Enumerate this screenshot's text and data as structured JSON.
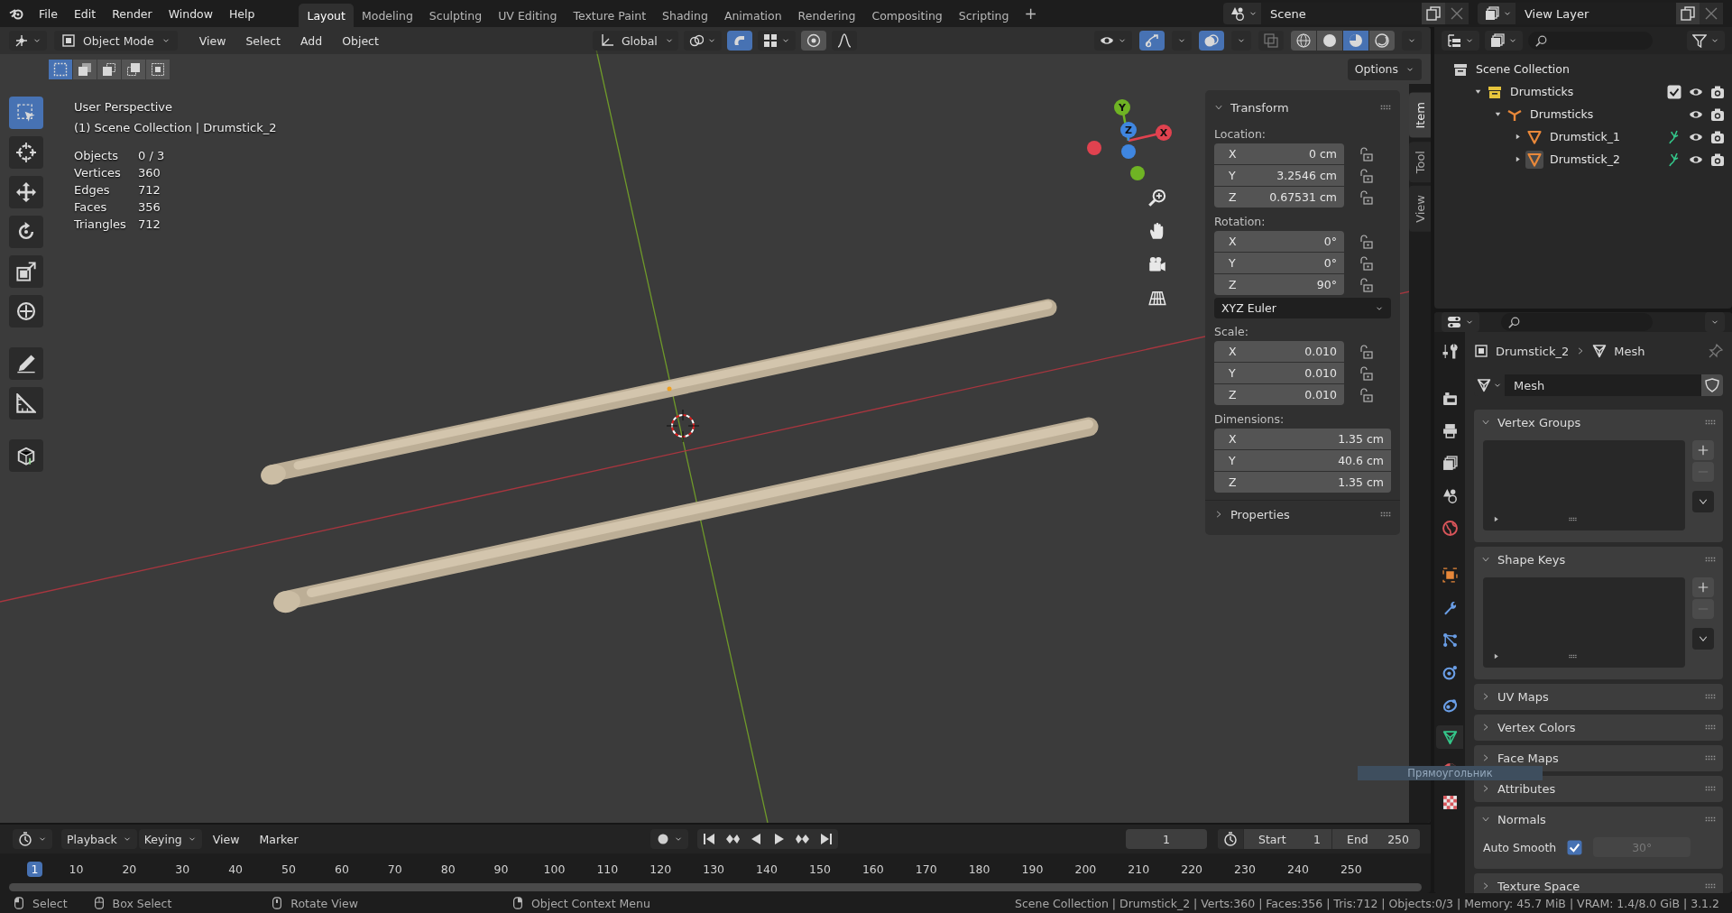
{
  "menu": [
    "File",
    "Edit",
    "Render",
    "Window",
    "Help"
  ],
  "workspaces": [
    {
      "label": "Layout",
      "selected": true
    },
    {
      "label": "Modeling",
      "selected": false
    },
    {
      "label": "Sculpting",
      "selected": false
    },
    {
      "label": "UV Editing",
      "selected": false
    },
    {
      "label": "Texture Paint",
      "selected": false
    },
    {
      "label": "Shading",
      "selected": false
    },
    {
      "label": "Animation",
      "selected": false
    },
    {
      "label": "Rendering",
      "selected": false
    },
    {
      "label": "Compositing",
      "selected": false
    },
    {
      "label": "Scripting",
      "selected": false
    }
  ],
  "add_workspace": "+",
  "scene": "Scene",
  "view_layer": "View Layer",
  "viewport": {
    "mode": "Object Mode",
    "menus": [
      "View",
      "Select",
      "Add",
      "Object"
    ],
    "orientation": "Global",
    "snap": {
      "on": true
    },
    "proportional": {
      "on": false
    },
    "gizmos": {
      "on": true
    },
    "overlays": {
      "on": true
    },
    "xray": {
      "on": false
    },
    "shading": [
      {
        "kind": "wireframe",
        "selected": false
      },
      {
        "kind": "solid",
        "selected": false
      },
      {
        "kind": "material",
        "selected": true
      },
      {
        "kind": "rendered",
        "selected": false
      }
    ],
    "select_modes": [
      {
        "selected": true
      },
      {
        "selected": false
      },
      {
        "selected": false
      },
      {
        "selected": false
      },
      {
        "selected": false
      }
    ],
    "options": "Options",
    "title": "User Perspective",
    "context": "(1) Scene Collection | Drumstick_2",
    "stats": [
      {
        "label": "Objects",
        "value": "0 / 3"
      },
      {
        "label": "Vertices",
        "value": "360"
      },
      {
        "label": "Edges",
        "value": "712"
      },
      {
        "label": "Faces",
        "value": "356"
      },
      {
        "label": "Triangles",
        "value": "712"
      }
    ],
    "tools": [
      {
        "kind": "select",
        "selected": true
      },
      {
        "kind": "cursor",
        "selected": false
      },
      {
        "kind": "move",
        "selected": false
      },
      {
        "kind": "rotate",
        "selected": false
      },
      {
        "kind": "scale",
        "selected": false
      },
      {
        "kind": "transform",
        "selected": false
      },
      {
        "kind": "annotate",
        "selected": false
      },
      {
        "kind": "measure",
        "selected": false
      },
      {
        "kind": "add_cube",
        "selected": false
      }
    ],
    "gizmo_axes": [
      {
        "label": "X",
        "color": "#e0424f"
      },
      {
        "label": "Y",
        "color": "#6fb324"
      },
      {
        "label": "Z",
        "color": "#3f86e0"
      }
    ],
    "nav_buttons": [
      {
        "kind": "zoom"
      },
      {
        "kind": "pan"
      },
      {
        "kind": "camera"
      },
      {
        "kind": "ortho"
      }
    ]
  },
  "sidebar": {
    "tabs": [
      {
        "label": "Item",
        "selected": true
      },
      {
        "label": "Tool",
        "selected": false
      },
      {
        "label": "View",
        "selected": false
      }
    ],
    "transform": {
      "title": "Transform",
      "expanded": true
    },
    "groups": [
      {
        "label": "Location:",
        "lockable": true,
        "fields": [
          {
            "axis": "X",
            "value": "0 cm"
          },
          {
            "axis": "Y",
            "value": "3.2546 cm"
          },
          {
            "axis": "Z",
            "value": "0.67531 cm"
          }
        ]
      },
      {
        "label": "Rotation:",
        "lockable": true,
        "mode": "XYZ Euler",
        "fields": [
          {
            "axis": "X",
            "value": "0°"
          },
          {
            "axis": "Y",
            "value": "0°"
          },
          {
            "axis": "Z",
            "value": "90°"
          }
        ]
      },
      {
        "label": "Scale:",
        "lockable": true,
        "fields": [
          {
            "axis": "X",
            "value": "0.010"
          },
          {
            "axis": "Y",
            "value": "0.010"
          },
          {
            "axis": "Z",
            "value": "0.010"
          }
        ]
      },
      {
        "label": "Dimensions:",
        "lockable": false,
        "fields": [
          {
            "axis": "X",
            "value": "1.35 cm"
          },
          {
            "axis": "Y",
            "value": "40.6 cm"
          },
          {
            "axis": "Z",
            "value": "1.35 cm"
          }
        ]
      }
    ],
    "properties": {
      "title": "Properties",
      "expanded": false
    }
  },
  "outliner": {
    "label": "Scene Collection",
    "children": [
      {
        "label": "Drumsticks",
        "kind": "collection",
        "expanded": true,
        "checked": true,
        "children": [
          {
            "label": "Drumsticks",
            "kind": "empty",
            "expanded": true,
            "children": [
              {
                "label": "Drumstick_1",
                "kind": "mesh",
                "expanded": false,
                "active": false
              },
              {
                "label": "Drumstick_2",
                "kind": "mesh",
                "expanded": false,
                "active": true
              }
            ]
          }
        ]
      }
    ]
  },
  "properties": {
    "tabs": [
      {
        "kind": "tool",
        "selected": false
      },
      {
        "kind": "render",
        "selected": false
      },
      {
        "kind": "output",
        "selected": false
      },
      {
        "kind": "view_layer",
        "selected": false
      },
      {
        "kind": "scene",
        "selected": false
      },
      {
        "kind": "world",
        "selected": false
      },
      {
        "kind": "object",
        "selected": false
      },
      {
        "kind": "modifiers",
        "selected": false
      },
      {
        "kind": "particles",
        "selected": false
      },
      {
        "kind": "physics",
        "selected": false
      },
      {
        "kind": "constraints",
        "selected": false
      },
      {
        "kind": "data",
        "selected": true
      },
      {
        "kind": "material",
        "selected": false
      },
      {
        "kind": "texture",
        "selected": false
      }
    ],
    "breadcrumb": [
      "Drumstick_2",
      "Mesh"
    ],
    "datablock": "Mesh",
    "panels": [
      {
        "title": "Vertex Groups",
        "expanded": true,
        "kind": "list"
      },
      {
        "title": "Shape Keys",
        "expanded": true,
        "kind": "list"
      },
      {
        "title": "UV Maps",
        "expanded": false,
        "kind": "plain"
      },
      {
        "title": "Vertex Colors",
        "expanded": false,
        "kind": "plain"
      },
      {
        "title": "Face Maps",
        "expanded": false,
        "kind": "plain"
      },
      {
        "title": "Attributes",
        "expanded": false,
        "kind": "plain"
      },
      {
        "title": "Normals",
        "expanded": true,
        "kind": "normals",
        "auto_smooth": {
          "label": "Auto Smooth",
          "checked": true,
          "angle": "30°"
        }
      },
      {
        "title": "Texture Space",
        "expanded": false,
        "kind": "plain"
      }
    ]
  },
  "tooltip": "Прямоугольник",
  "timeline": {
    "menus": [
      "Playback",
      "Keying",
      "View",
      "Marker"
    ],
    "auto_key": {
      "on": false
    },
    "current_frame": "1",
    "start": {
      "label": "Start",
      "value": "1"
    },
    "end": {
      "label": "End",
      "value": "250"
    },
    "ruler": [
      {
        "label": "1",
        "selected": true
      },
      {
        "label": "10",
        "selected": false
      },
      {
        "label": "20",
        "selected": false
      },
      {
        "label": "30",
        "selected": false
      },
      {
        "label": "40",
        "selected": false
      },
      {
        "label": "50",
        "selected": false
      },
      {
        "label": "60",
        "selected": false
      },
      {
        "label": "70",
        "selected": false
      },
      {
        "label": "80",
        "selected": false
      },
      {
        "label": "90",
        "selected": false
      },
      {
        "label": "100",
        "selected": false
      },
      {
        "label": "110",
        "selected": false
      },
      {
        "label": "120",
        "selected": false
      },
      {
        "label": "130",
        "selected": false
      },
      {
        "label": "140",
        "selected": false
      },
      {
        "label": "150",
        "selected": false
      },
      {
        "label": "160",
        "selected": false
      },
      {
        "label": "170",
        "selected": false
      },
      {
        "label": "180",
        "selected": false
      },
      {
        "label": "190",
        "selected": false
      },
      {
        "label": "200",
        "selected": false
      },
      {
        "label": "210",
        "selected": false
      },
      {
        "label": "220",
        "selected": false
      },
      {
        "label": "230",
        "selected": false
      },
      {
        "label": "240",
        "selected": false
      },
      {
        "label": "250",
        "selected": false
      }
    ]
  },
  "status": {
    "hints": [
      {
        "kind": "left",
        "label": "Select"
      },
      {
        "kind": "drag",
        "label": "Box Select"
      },
      {
        "kind": "middle",
        "label": "Rotate View"
      },
      {
        "kind": "right",
        "label": "Object Context Menu"
      }
    ],
    "info": "Scene Collection | Drumstick_2 | Verts:360 | Faces:356 | Tris:712 | Objects:0/3 | Memory: 45.7 MiB | VRAM: 1.4/8.0 GiB | 3.1.2"
  }
}
